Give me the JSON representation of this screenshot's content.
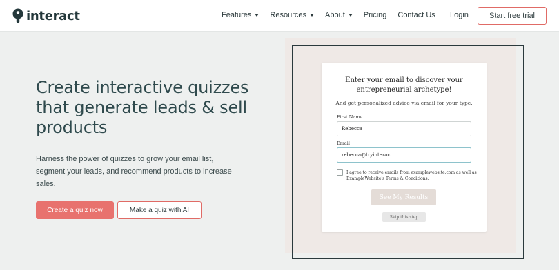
{
  "header": {
    "logo_text": "interact",
    "nav": [
      {
        "label": "Features",
        "has_dropdown": true
      },
      {
        "label": "Resources",
        "has_dropdown": true
      },
      {
        "label": "About",
        "has_dropdown": true
      },
      {
        "label": "Pricing",
        "has_dropdown": false
      },
      {
        "label": "Contact Us",
        "has_dropdown": false
      }
    ],
    "login_label": "Login",
    "cta_label": "Start free trial"
  },
  "hero": {
    "title": "Create interactive quizzes that generate leads & sell products",
    "subtitle": "Harness the power of quizzes to grow your email list, segment your leads, and recommend products to increase sales.",
    "primary_button": "Create a quiz now",
    "secondary_button": "Make a quiz with AI"
  },
  "quiz_preview": {
    "heading": "Enter your email to discover your entrepreneurial archetype!",
    "subheading": "And get personalized advice via email for your type.",
    "first_name_label": "First Name",
    "first_name_value": "Rebecca",
    "email_label": "Email",
    "email_value": "rebecca@tryinterac",
    "consent_text": "I agree to receive emails from examplewebsite.com as well as ExampleWebsite's Terms & Conditions.",
    "consent_checked": false,
    "results_button": "See My Results",
    "skip_button": "Skip this step"
  },
  "colors": {
    "accent": "#e8726e",
    "heading_text": "#2f4a4d",
    "preview_background": "#efe9e6",
    "page_background": "#eef0ef"
  }
}
